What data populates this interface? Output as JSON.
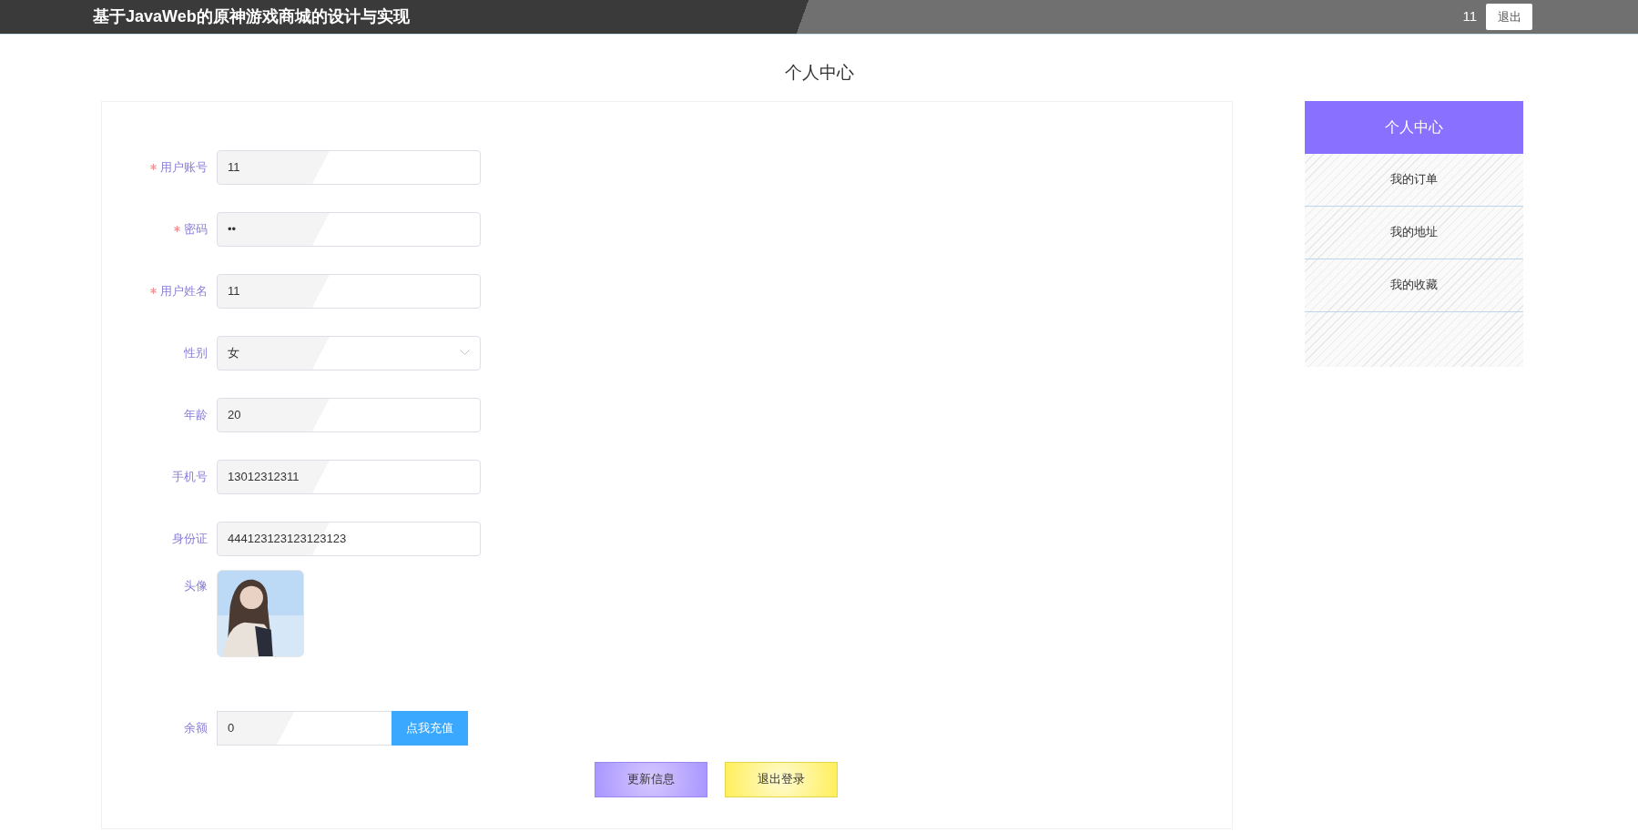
{
  "header": {
    "title": "基于JavaWeb的原神游戏商城的设计与实现",
    "username": "11",
    "logout_button": "退出"
  },
  "page_title": "个人中心",
  "form": {
    "fields": [
      {
        "kind": "input",
        "label": "用户账号",
        "required": true,
        "value": "11"
      },
      {
        "kind": "input",
        "label": "密码",
        "required": true,
        "value": "••"
      },
      {
        "kind": "input",
        "label": "用户姓名",
        "required": true,
        "value": "11"
      },
      {
        "kind": "select",
        "label": "性别",
        "required": false,
        "value": "女"
      },
      {
        "kind": "input",
        "label": "年龄",
        "required": false,
        "value": "20"
      },
      {
        "kind": "input",
        "label": "手机号",
        "required": false,
        "value": "13012312311"
      },
      {
        "kind": "input",
        "label": "身份证",
        "required": false,
        "value": "444123123123123123"
      },
      {
        "label": "头像",
        "required": false
      },
      {
        "kind": "balance",
        "label": "余额",
        "required": false,
        "value": "0",
        "button": "点我充值"
      }
    ],
    "buttons": [
      {
        "kind": "primary",
        "label": "更新信息"
      },
      {
        "kind": "warning",
        "label": "退出登录"
      }
    ]
  },
  "sidebar": {
    "title": "个人中心",
    "items": [
      {
        "label": "我的订单"
      },
      {
        "label": "我的地址"
      },
      {
        "label": "我的收藏"
      }
    ]
  }
}
